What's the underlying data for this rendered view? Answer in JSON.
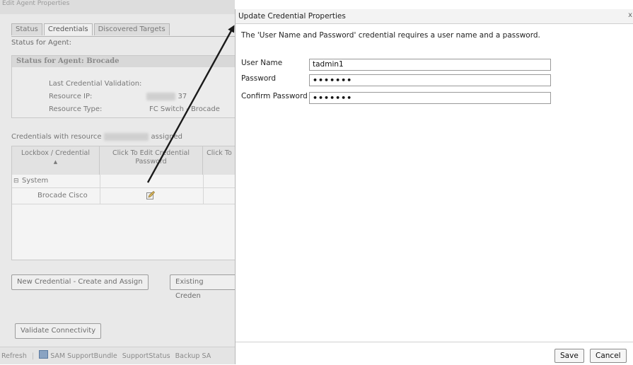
{
  "background_window": {
    "title": "Edit Agent Properties",
    "tabs": [
      {
        "label": "Status",
        "active": false
      },
      {
        "label": "Credentials",
        "active": true
      },
      {
        "label": "Discovered Targets",
        "active": false
      }
    ],
    "status_for_label": "Status for Agent:",
    "status_header": "Status for Agent: Brocade",
    "fields": {
      "last_validation_label": "Last Credential Validation:",
      "resource_ip_label": "Resource IP:",
      "resource_ip_value": "37",
      "resource_type_label": "Resource Type:",
      "resource_type_value": "FC Switch - Brocade"
    },
    "credentials_line_prefix": "Credentials with resource",
    "credentials_line_suffix": "assigned",
    "grid": {
      "col1": "Lockbox / Credential",
      "col2": "Click To Edit Credential Password",
      "col3": "Click To",
      "group_row": "System",
      "item_row": "Brocade Cisco"
    },
    "buttons": {
      "new_credential": "New Credential - Create and Assign",
      "existing_credential": "Existing Creden",
      "validate": "Validate Connectivity"
    },
    "statusbar": {
      "refresh": "Refresh",
      "sam_bundle": "SAM SupportBundle",
      "support_status": "SupportStatus",
      "backup": "Backup SA"
    }
  },
  "dialog": {
    "title": "Update Credential Properties",
    "close_glyph": "x",
    "message": "The 'User Name and Password' credential requires a user name and a password.",
    "fields": {
      "username_label": "User Name",
      "username_value": "tadmin1",
      "password_label": "Password",
      "password_mask": "•••••••",
      "confirm_label": "Confirm Password",
      "confirm_mask": "•••••••"
    },
    "buttons": {
      "save": "Save",
      "cancel": "Cancel"
    }
  },
  "colors": {
    "arrow": "#1a1a1a",
    "dim_background": "#e9e9e9"
  },
  "icons": {
    "edit": "edit-pencil-icon",
    "expand": "collapse-minus-icon",
    "sort": "sort-up-icon"
  }
}
